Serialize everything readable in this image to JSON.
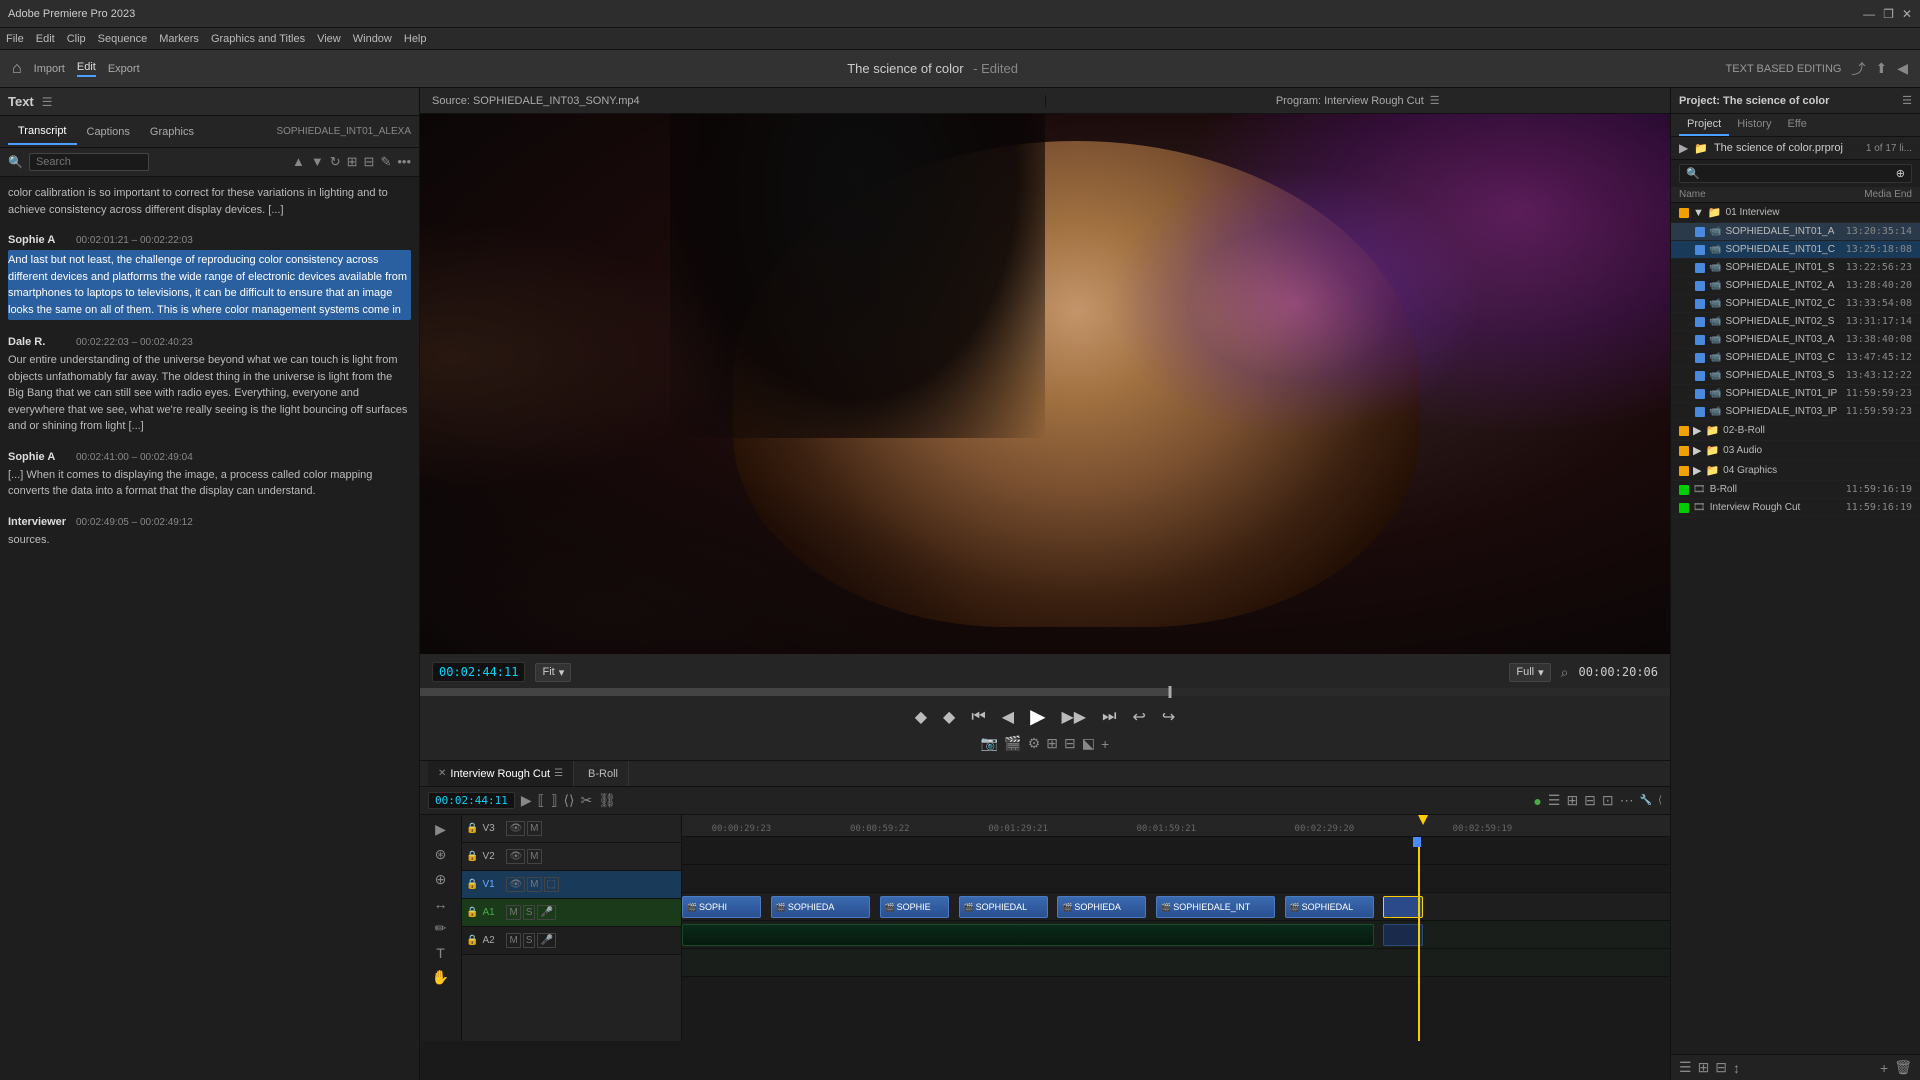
{
  "titlebar": {
    "title": "Adobe Premiere Pro 2023",
    "controls": [
      "—",
      "❐",
      "✕"
    ]
  },
  "menubar": {
    "items": [
      "File",
      "Edit",
      "Clip",
      "Sequence",
      "Markers",
      "Graphics and Titles",
      "View",
      "Window",
      "Help"
    ]
  },
  "toolbar": {
    "home_icon": "⌂",
    "import_label": "Import",
    "edit_label": "Edit",
    "export_label": "Export",
    "center_title": "The science of color",
    "edited_label": "- Edited",
    "text_based_editing": "TEXT BASED EDITING"
  },
  "left_panel": {
    "header_label": "Text",
    "menu_icon": "☰",
    "tabs": [
      "Transcript",
      "Captions",
      "Graphics"
    ],
    "active_tab": "Transcript",
    "source_label": "SOPHIEDALE_INT01_ALEXA",
    "search_placeholder": "Search"
  },
  "transcript": {
    "entries": [
      {
        "speaker": "",
        "timestamp": "",
        "text": "color calibration is so important to correct for these variations in lighting and to achieve consistency across different display devices. [...]",
        "highlighted": false
      },
      {
        "speaker": "Sophie A",
        "timestamp": "00:02:01:21 – 00:02:22:03",
        "text": "And last but not least, the challenge of reproducing color consistency across different devices and platforms the wide range of electronic devices available from smartphones to laptops to televisions, it can be difficult to ensure that an image looks the same on all of them. This is where color management systems come in",
        "highlighted": true
      },
      {
        "speaker": "Dale R.",
        "timestamp": "00:02:22:03 – 00:02:40:23",
        "text": "Our entire understanding of the universe beyond what we can touch is light from objects unfathomably far away. The oldest thing in the universe is light from the Big Bang that we can still see with radio eyes. Everything, everyone and everywhere that we see, what we're really seeing is the light bouncing off surfaces and or shining from light [...]",
        "highlighted": false
      },
      {
        "speaker": "Sophie A",
        "timestamp": "00:02:41:00 – 00:02:49:04",
        "text": "[...] When it comes to displaying the image, a process called color mapping converts the data into a format that the display can understand.",
        "highlighted": false
      },
      {
        "speaker": "Interviewer",
        "timestamp": "00:02:49:05 – 00:02:49:12",
        "text": "sources.",
        "highlighted": false
      }
    ]
  },
  "preview": {
    "source_label": "Source: SOPHIEDALE_INT03_SONY.mp4",
    "program_label": "Program: Interview Rough Cut",
    "program_menu_icon": "☰",
    "timecode": "00:02:44:11",
    "fit_label": "Fit",
    "fit_icon": "▾",
    "full_label": "Full",
    "full_icon": "▾",
    "zoom_icon": "⌕",
    "duration": "00:00:20:06"
  },
  "transport": {
    "mark_in": "◆",
    "mark_out": "◆",
    "prev_frame": "⏮",
    "step_back": "◀",
    "play": "▶",
    "step_fwd": "▶",
    "next_frame": "⏭",
    "extra_btns": [
      "⟦",
      "⟧",
      "⌞",
      "⌞",
      "⌞",
      "⌞",
      "⌞",
      "⌞"
    ]
  },
  "timeline": {
    "tabs": [
      "Interview Rough Cut",
      "B-Roll"
    ],
    "active_tab": "Interview Rough Cut",
    "timecode": "00:02:44:11",
    "ruler_marks": [
      "00:00:29:23",
      "00:00:59:22",
      "00:01:29:21",
      "00:01:59:21",
      "00:02:29:20",
      "00:02:59:19"
    ],
    "tracks": [
      {
        "name": "V3",
        "type": "video",
        "clips": []
      },
      {
        "name": "V2",
        "type": "video",
        "clips": []
      },
      {
        "name": "V1",
        "type": "video",
        "active": true,
        "clips": [
          {
            "label": "SOPHI",
            "start": 0,
            "width": 9
          },
          {
            "label": "SOPHIEDA",
            "start": 10,
            "width": 11
          },
          {
            "label": "SOPHIE",
            "start": 22,
            "width": 8
          },
          {
            "label": "SOPHIEDAL",
            "start": 31,
            "width": 10
          },
          {
            "label": "SOPHIEDA",
            "start": 42,
            "width": 10
          },
          {
            "label": "SOPHIEDALE_INT",
            "start": 53,
            "width": 12
          },
          {
            "label": "SOPHIEDAL",
            "start": 66,
            "width": 10
          },
          {
            "label": "",
            "start": 77,
            "width": 4
          }
        ]
      },
      {
        "name": "A1",
        "type": "audio",
        "active": true,
        "clips": []
      },
      {
        "name": "A2",
        "type": "audio",
        "clips": []
      }
    ]
  },
  "right_panel": {
    "title": "Project: The science of color",
    "history_label": "History",
    "effect_label": "Effe",
    "menu_icon": "☰",
    "folder": "The science of color.prproj",
    "count": "1 of 17 li...",
    "items": [
      {
        "color": "#f0a000",
        "type": "folder",
        "expanded": true,
        "name": "01 Interview",
        "end": ""
      },
      {
        "color": "#4a8adc",
        "type": "file",
        "name": "SOPHIEDALE_INT01_A",
        "end": "13:20:35:14",
        "indent": true,
        "highlighted": true
      },
      {
        "color": "#4a8adc",
        "type": "file",
        "name": "SOPHIEDALE_INT01_C",
        "end": "13:25:18:08",
        "indent": true,
        "selected": true
      },
      {
        "color": "#4a8adc",
        "type": "file",
        "name": "SOPHIEDALE_INT01_S",
        "end": "13:22:56:23",
        "indent": true
      },
      {
        "color": "#4a8adc",
        "type": "file",
        "name": "SOPHIEDALE_INT02_A",
        "end": "13:28:40:20",
        "indent": true
      },
      {
        "color": "#4a8adc",
        "type": "file",
        "name": "SOPHIEDALE_INT02_C",
        "end": "13:33:54:08",
        "indent": true
      },
      {
        "color": "#4a8adc",
        "type": "file",
        "name": "SOPHIEDALE_INT02_S",
        "end": "13:31:17:14",
        "indent": true
      },
      {
        "color": "#4a8adc",
        "type": "file",
        "name": "SOPHIEDALE_INT03_A",
        "end": "13:38:40:08",
        "indent": true
      },
      {
        "color": "#4a8adc",
        "type": "file",
        "name": "SOPHIEDALE_INT03_C",
        "end": "13:47:45:12",
        "indent": true
      },
      {
        "color": "#4a8adc",
        "type": "file",
        "name": "SOPHIEDALE_INT03_S",
        "end": "13:43:12:22",
        "indent": true
      },
      {
        "color": "#4a8adc",
        "type": "file",
        "name": "SOPHIEDALE_INT01_IP",
        "end": "11:59:59:23",
        "indent": true
      },
      {
        "color": "#4a8adc",
        "type": "file",
        "name": "SOPHIEDALE_INT03_IP",
        "end": "11:59:59:23",
        "indent": true
      },
      {
        "color": "#f0a000",
        "type": "folder",
        "expanded": false,
        "name": "02-B-Roll",
        "end": ""
      },
      {
        "color": "#f0a000",
        "type": "folder",
        "expanded": false,
        "name": "03 Audio",
        "end": ""
      },
      {
        "color": "#f0a000",
        "type": "folder",
        "expanded": false,
        "name": "04 Graphics",
        "end": ""
      },
      {
        "color": "#00cc00",
        "type": "sequence",
        "name": "B-Roll",
        "end": "11:59:16:19"
      },
      {
        "color": "#00cc00",
        "type": "sequence",
        "name": "Interview Rough Cut",
        "end": "11:59:16:19"
      }
    ]
  }
}
